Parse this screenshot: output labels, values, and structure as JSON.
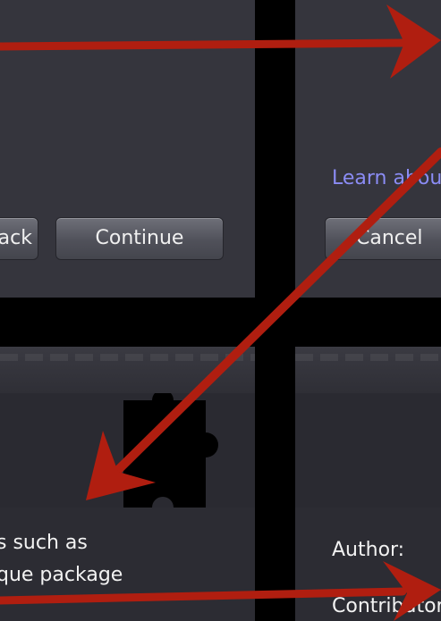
{
  "top_left": {
    "back_label": "Back",
    "continue_label": "Continue"
  },
  "top_right": {
    "learn_link": "Learn about",
    "cancel_label": "Cancel"
  },
  "bottom_left": {
    "body_line_1": "s such as",
    "body_line_2": "que package"
  },
  "bottom_right": {
    "author_label": "Author:",
    "contributors_label": "Contributors:"
  },
  "annotation": {
    "arrow_color": "#b01e10"
  }
}
